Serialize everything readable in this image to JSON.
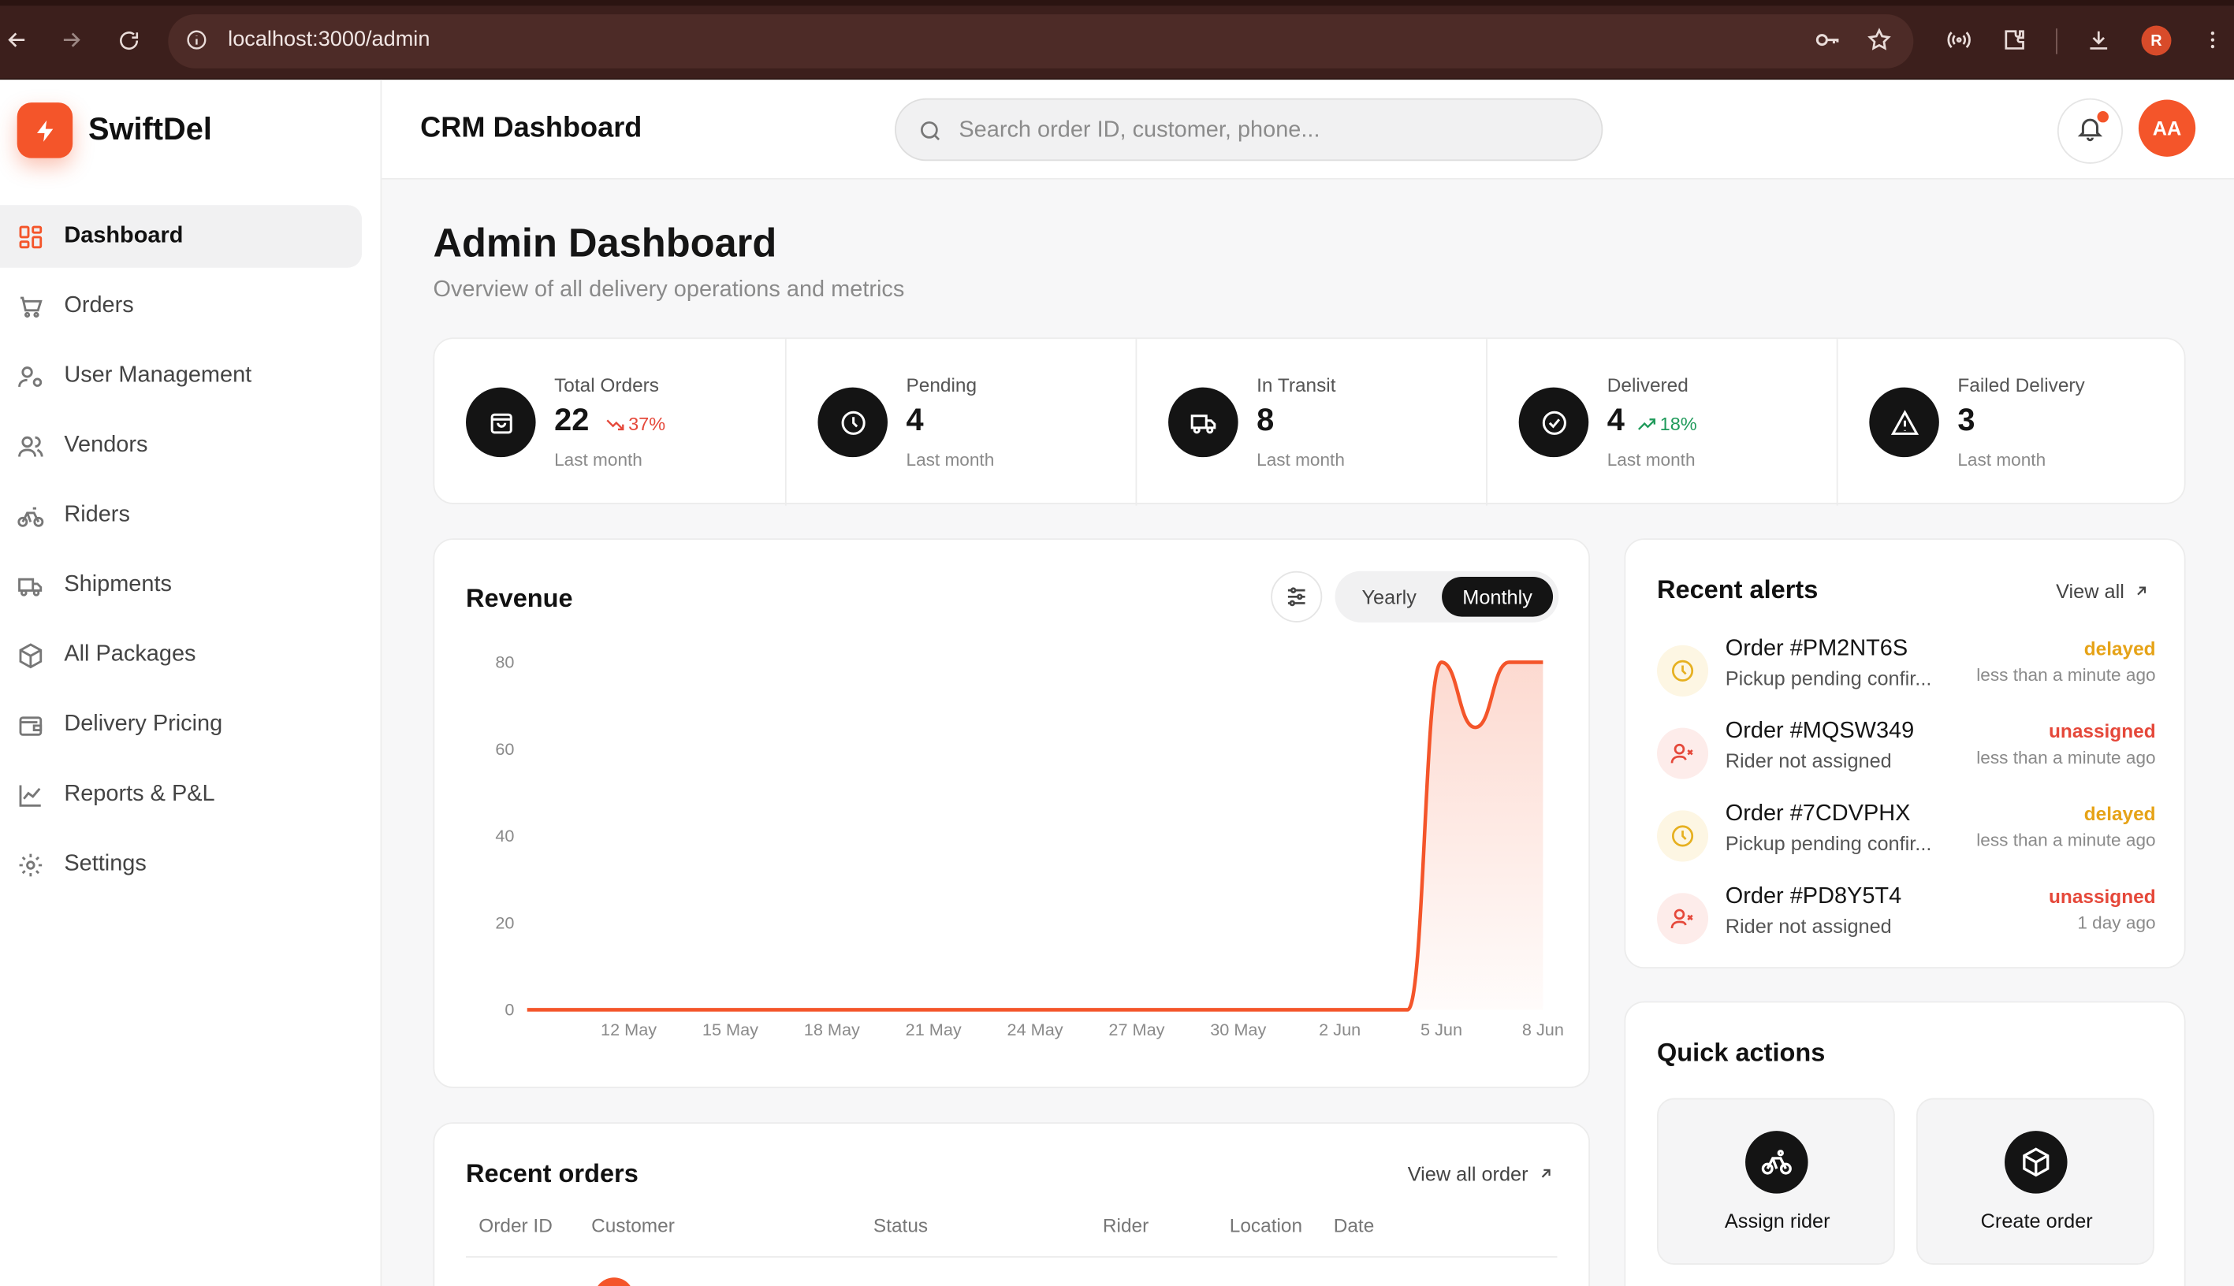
{
  "browser": {
    "url": "localhost:3000/admin",
    "profile_initial": "R"
  },
  "brand": {
    "name": "SwiftDel",
    "accent": "#f4552a"
  },
  "sidebar": {
    "items": [
      {
        "label": "Dashboard",
        "icon": "dashboard-grid-icon",
        "active": true
      },
      {
        "label": "Orders",
        "icon": "cart-icon"
      },
      {
        "label": "User Management",
        "icon": "user-gear-icon"
      },
      {
        "label": "Vendors",
        "icon": "users-icon"
      },
      {
        "label": "Riders",
        "icon": "bicycle-icon"
      },
      {
        "label": "Shipments",
        "icon": "truck-icon"
      },
      {
        "label": "All Packages",
        "icon": "package-icon"
      },
      {
        "label": "Delivery Pricing",
        "icon": "wallet-icon"
      },
      {
        "label": "Reports & P&L",
        "icon": "line-chart-icon"
      },
      {
        "label": "Settings",
        "icon": "gear-icon"
      }
    ]
  },
  "header": {
    "title": "CRM Dashboard",
    "search_placeholder": "Search order ID, customer, phone...",
    "avatar_initials": "AA"
  },
  "main": {
    "title": "Admin Dashboard",
    "subtitle": "Overview of all delivery operations and metrics"
  },
  "stats": [
    {
      "label": "Total Orders",
      "value": "22",
      "trend": "37%",
      "trend_dir": "down",
      "footer": "Last month",
      "icon": "bag-icon"
    },
    {
      "label": "Pending",
      "value": "4",
      "trend": "",
      "trend_dir": "",
      "footer": "Last month",
      "icon": "clock-icon"
    },
    {
      "label": "In Transit",
      "value": "8",
      "trend": "",
      "trend_dir": "",
      "footer": "Last month",
      "icon": "truck-icon"
    },
    {
      "label": "Delivered",
      "value": "4",
      "trend": "18%",
      "trend_dir": "up",
      "footer": "Last month",
      "icon": "check-circle-icon"
    },
    {
      "label": "Failed Delivery",
      "value": "3",
      "trend": "",
      "trend_dir": "",
      "footer": "Last month",
      "icon": "warning-icon"
    }
  ],
  "revenue": {
    "title": "Revenue",
    "toggle": {
      "yearly": "Yearly",
      "monthly": "Monthly",
      "selected": "Monthly"
    }
  },
  "chart_data": {
    "type": "area",
    "title": "Revenue",
    "xlabel": "",
    "ylabel": "",
    "x": [
      "9 May",
      "10 May",
      "11 May",
      "12 May",
      "13 May",
      "14 May",
      "15 May",
      "16 May",
      "17 May",
      "18 May",
      "19 May",
      "20 May",
      "21 May",
      "22 May",
      "23 May",
      "24 May",
      "25 May",
      "26 May",
      "27 May",
      "28 May",
      "29 May",
      "30 May",
      "31 May",
      "1 Jun",
      "2 Jun",
      "3 Jun",
      "4 Jun",
      "5 Jun",
      "6 Jun",
      "7 Jun",
      "8 Jun"
    ],
    "series": [
      {
        "values": [
          0,
          0,
          0,
          0,
          0,
          0,
          0,
          0,
          0,
          0,
          0,
          0,
          0,
          0,
          0,
          0,
          0,
          0,
          0,
          0,
          0,
          0,
          0,
          0,
          0,
          0,
          0,
          80,
          65,
          80,
          80
        ]
      }
    ],
    "x_tick_labels": [
      "12 May",
      "15 May",
      "18 May",
      "21 May",
      "24 May",
      "27 May",
      "30 May",
      "2 Jun",
      "5 Jun",
      "8 Jun"
    ],
    "y_ticks": [
      "0",
      "20",
      "40",
      "60",
      "80"
    ],
    "ylim": [
      0,
      80
    ],
    "line_color": "#f4552a",
    "grid": false,
    "legend": "none"
  },
  "recent_orders": {
    "title": "Recent orders",
    "view_all": "View all order",
    "columns": [
      "Order ID",
      "Customer",
      "Status",
      "Rider",
      "Location",
      "Date"
    ]
  },
  "alerts": {
    "title": "Recent alerts",
    "view_all": "View all",
    "items": [
      {
        "order": "Order #PM2NT6S",
        "desc": "Pickup pending confir...",
        "status": "delayed",
        "time": "less than a minute ago",
        "icon": "clock-icon"
      },
      {
        "order": "Order #MQSW349",
        "desc": "Rider not assigned",
        "status": "unassigned",
        "time": "less than a minute ago",
        "icon": "user-x-icon"
      },
      {
        "order": "Order #7CDVPHX",
        "desc": "Pickup pending confir...",
        "status": "delayed",
        "time": "less than a minute ago",
        "icon": "clock-icon"
      },
      {
        "order": "Order #PD8Y5T4",
        "desc": "Rider not assigned",
        "status": "unassigned",
        "time": "1 day ago",
        "icon": "user-x-icon"
      }
    ]
  },
  "quick_actions": {
    "title": "Quick actions",
    "items": [
      {
        "label": "Assign rider",
        "icon": "bicycle-icon"
      },
      {
        "label": "Create order",
        "icon": "package-plus-icon"
      }
    ]
  }
}
